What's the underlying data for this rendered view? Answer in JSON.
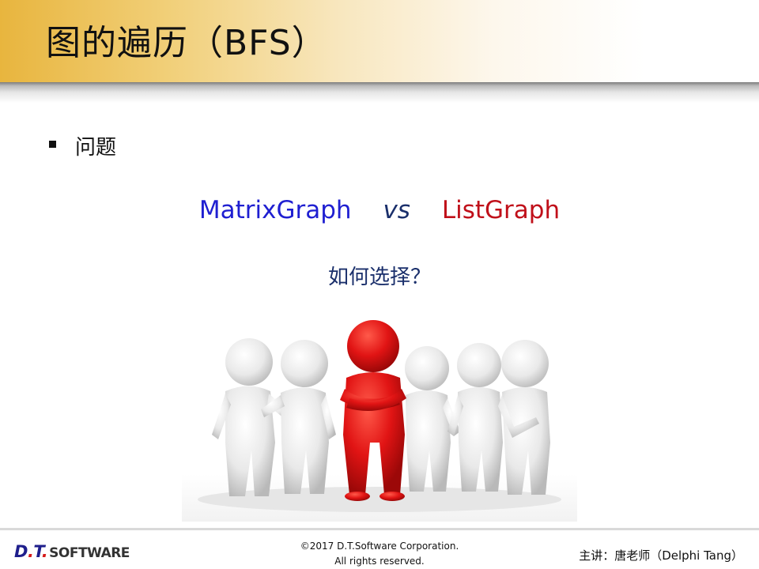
{
  "slide": {
    "title": "图的遍历（BFS）",
    "bullet": "问题",
    "comparison": {
      "left": "MatrixGraph",
      "middle": "vs",
      "right": "ListGraph",
      "left_color": "#1f1fd1",
      "right_color": "#c0101a"
    },
    "question": "如何选择？"
  },
  "illustration": {
    "icon": "group-of-figures-with-red-leader-icon",
    "highlight_color": "#e11414"
  },
  "footer": {
    "logo_dt": "D",
    "logo_t": "T",
    "logo_software": "SOFTWARE",
    "copyright_line1": "©2017 D.T.Software Corporation.",
    "copyright_line2": "All rights reserved.",
    "lecturer": "主讲：唐老师（Delphi Tang）"
  }
}
